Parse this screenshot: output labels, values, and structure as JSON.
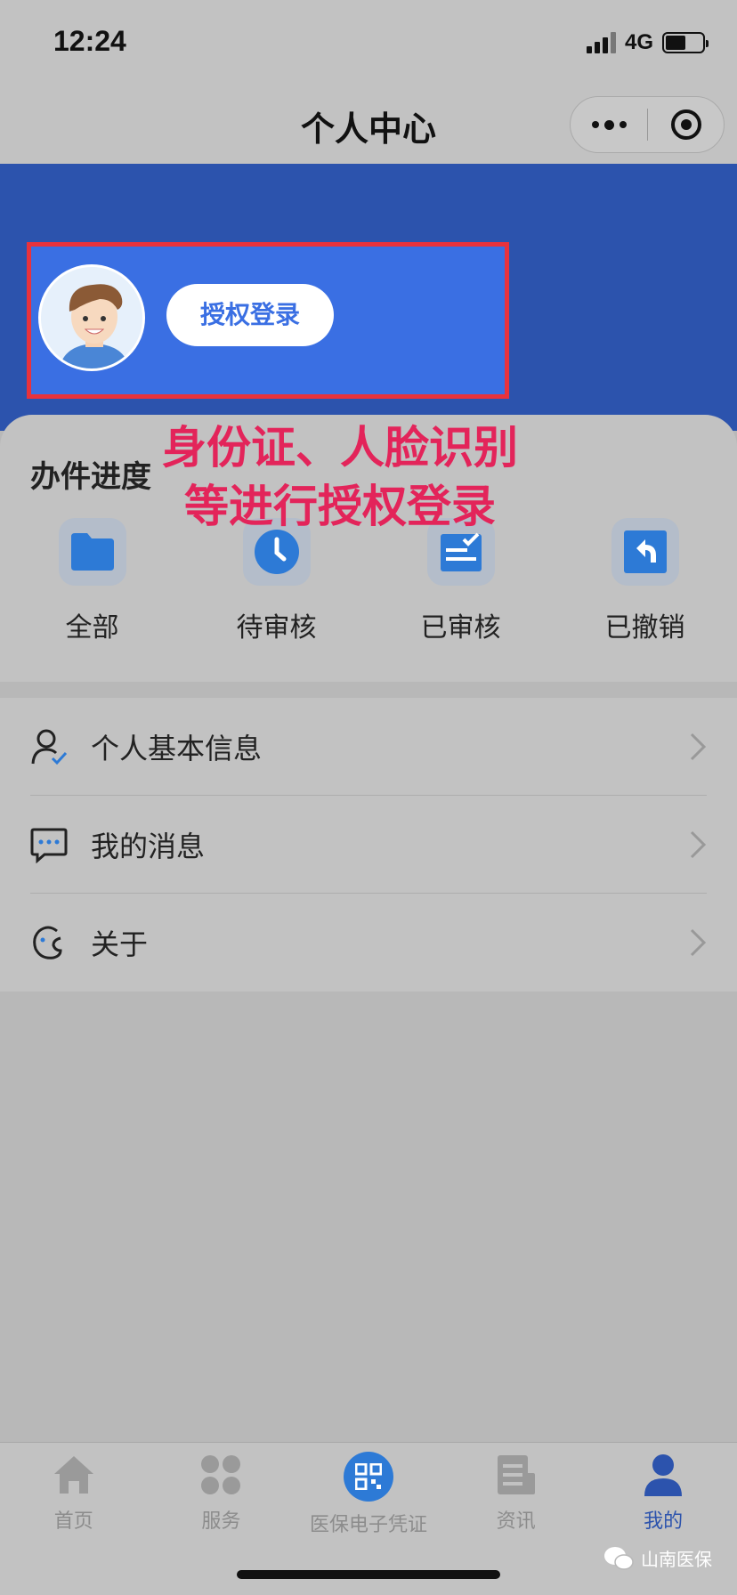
{
  "status_bar": {
    "time": "12:24",
    "network": "4G",
    "battery_level": 0.55
  },
  "nav": {
    "title": "个人中心"
  },
  "login": {
    "button_label": "授权登录",
    "highlight_color": "#e8323c"
  },
  "annotation": {
    "text": "身份证、人脸识别等进行授权登录",
    "color": "#e3245a"
  },
  "progress": {
    "title": "办件进度",
    "items": [
      {
        "label": "全部",
        "icon": "folder-icon"
      },
      {
        "label": "待审核",
        "icon": "clock-icon"
      },
      {
        "label": "已审核",
        "icon": "reviewed-check-icon"
      },
      {
        "label": "已撤销",
        "icon": "undo-arrow-icon"
      }
    ]
  },
  "menu": {
    "items": [
      {
        "label": "个人基本信息",
        "icon": "user-check-icon"
      },
      {
        "label": "我的消息",
        "icon": "message-icon"
      },
      {
        "label": "关于",
        "icon": "about-icon"
      }
    ]
  },
  "tabs": {
    "items": [
      {
        "label": "首页",
        "icon": "home-icon"
      },
      {
        "label": "服务",
        "icon": "grid-icon"
      },
      {
        "label": "医保电子凭证",
        "icon": "qr-code-icon"
      },
      {
        "label": "资讯",
        "icon": "news-icon"
      },
      {
        "label": "我的",
        "icon": "user-icon"
      }
    ],
    "active_index": 4
  },
  "watermark": {
    "text": "山南医保"
  },
  "colors": {
    "brand_blue": "#2c53ad",
    "accent_blue": "#3a6fe3",
    "icon_blue": "#2d7ad6"
  }
}
